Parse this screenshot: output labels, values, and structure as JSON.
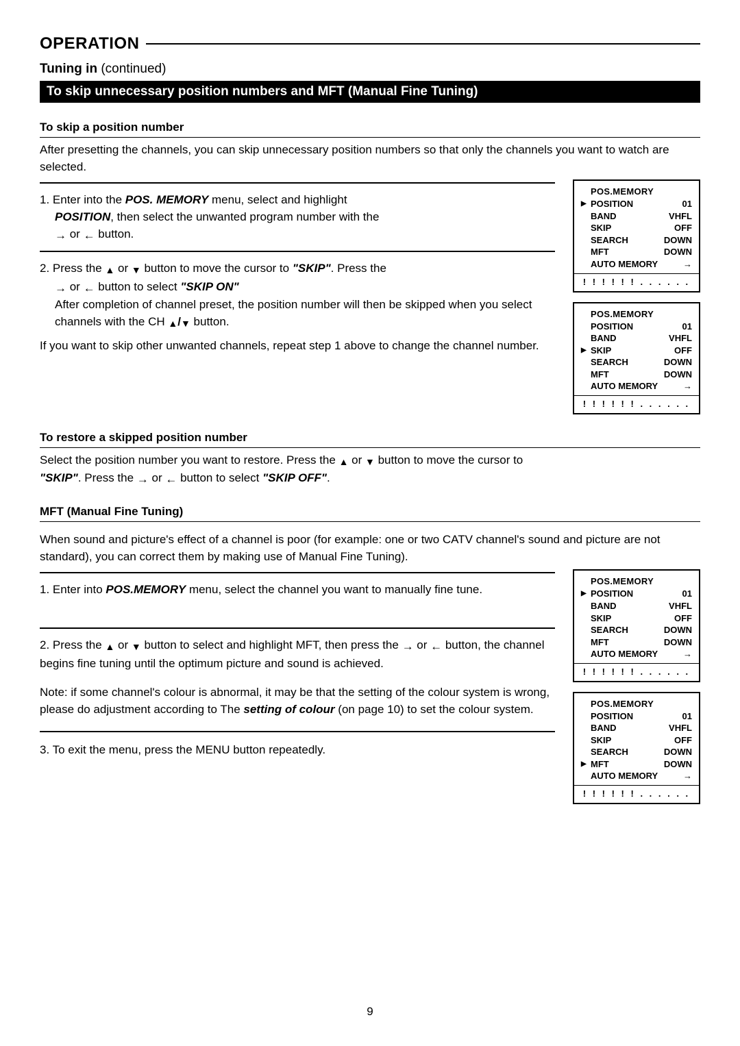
{
  "header": {
    "operation": "OPERATION",
    "subtitle_prefix": "Tuning in ",
    "subtitle_suffix": "(continued)",
    "blackbar": "To skip unnecessary position numbers and MFT (Manual Fine Tuning)"
  },
  "section_skip": {
    "heading": "To skip a position number",
    "intro": "After presetting the channels, you can skip unnecessary position numbers so that only the channels you want to watch are selected.",
    "step1_pre": "1. Enter into the ",
    "step1_pos": "POS. MEMORY",
    "step1_mid": " menu, select and highlight ",
    "step1_position": "POSITION",
    "step1_post": ", then select the unwanted program number with the ",
    "step1_end": " button.",
    "or": " or ",
    "step2_pre": "2. Press the ",
    "step2_mid": " button to move the cursor to ",
    "step2_skip": "\"SKIP\"",
    "step2_post": ". Press the ",
    "step2_line2_mid": " button to select ",
    "step2_skip_on": "\"SKIP ON\"",
    "step2_after1": "After completion of channel preset, the position number will then be skipped when you select channels with the CH ",
    "step2_after2": " button.",
    "repeat": "If you want to skip other unwanted channels, repeat step 1 above to change the channel number."
  },
  "section_restore": {
    "heading": "To restore a skipped position number",
    "body_pre": "Select the position number you want to restore. Press the ",
    "body_mid": " button to move the cursor to ",
    "body_skip": "\"SKIP\"",
    "body_post": ". Press the ",
    "body_mid2": " button to select ",
    "body_skip_off": "\"SKIP OFF\"",
    "body_end": "."
  },
  "section_mft": {
    "heading": "MFT (Manual Fine Tuning)",
    "intro": "When sound and picture's effect of a channel is poor (for example: one or two CATV channel's sound and picture are not standard), you can correct them by making use of Manual Fine Tuning).",
    "step1_pre": "1. Enter into ",
    "step1_pos": "POS.MEMORY",
    "step1_post": " menu, select the channel you want to manually fine tune.",
    "step2_pre": "2. Press the ",
    "step2_mid": " button to select and highlight MFT, then press the ",
    "step2_post": " button, the channel begins fine tuning until the optimum picture and sound is achieved.",
    "note_pre": "Note: if some channel's colour is abnormal, it may be that the setting of the colour system is wrong, please do adjustment according to The ",
    "note_bold": "setting of colour",
    "note_post": " (on page 10) to set the colour system.",
    "step3": "3. To exit the menu, press the MENU button repeatedly."
  },
  "osd_labels": {
    "title": "POS.MEMORY",
    "position": "POSITION",
    "band": "BAND",
    "skip": "SKIP",
    "search": "SEARCH",
    "mft": "MFT",
    "auto_memory": "AUTO MEMORY",
    "val_01": "01",
    "val_vhfl": "VHFL",
    "val_off": "OFF",
    "val_down": "DOWN",
    "arrow": "→",
    "dots": "! ! ! ! ! ! . . . . . ."
  },
  "page_number": "9"
}
